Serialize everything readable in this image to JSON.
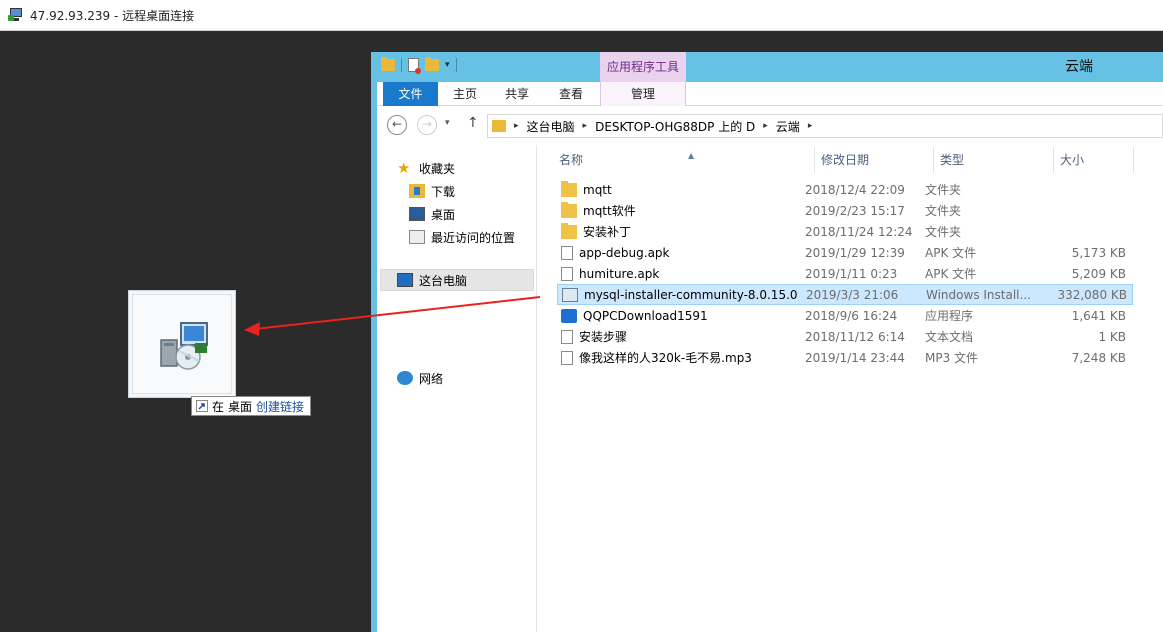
{
  "rdp": {
    "title": "47.92.93.239 - 远程桌面连接"
  },
  "drag": {
    "tooltip_prefix": "在",
    "tooltip_target": "桌面",
    "tooltip_action": "创建链接"
  },
  "explorer": {
    "window_title": "云端",
    "contextual_tab": "应用程序工具",
    "tabs": [
      "文件",
      "主页",
      "共享",
      "查看",
      "管理"
    ],
    "breadcrumb": [
      "这台电脑",
      "DESKTOP-OHG88DP 上的 D",
      "云端"
    ],
    "nav": {
      "favorites": "收藏夹",
      "downloads": "下载",
      "desktop": "桌面",
      "recent": "最近访问的位置",
      "this_pc": "这台电脑",
      "network": "网络"
    },
    "columns": [
      "名称",
      "修改日期",
      "类型",
      "大小"
    ],
    "files": [
      {
        "name": "mqtt",
        "date": "2018/12/4 22:09",
        "type": "文件夹",
        "size": "",
        "icon": "folder-icon"
      },
      {
        "name": "mqtt软件",
        "date": "2019/2/23 15:17",
        "type": "文件夹",
        "size": "",
        "icon": "folder-icon"
      },
      {
        "name": "安装补丁",
        "date": "2018/11/24 12:24",
        "type": "文件夹",
        "size": "",
        "icon": "folder-icon"
      },
      {
        "name": "app-debug.apk",
        "date": "2019/1/29 12:39",
        "type": "APK 文件",
        "size": "5,173 KB",
        "icon": "file-icon"
      },
      {
        "name": "humiture.apk",
        "date": "2019/1/11 0:23",
        "type": "APK 文件",
        "size": "5,209 KB",
        "icon": "file-icon"
      },
      {
        "name": "mysql-installer-community-8.0.15.0",
        "date": "2019/3/3 21:06",
        "type": "Windows Install...",
        "size": "332,080 KB",
        "icon": "installer-icon"
      },
      {
        "name": "QQPCDownload1591",
        "date": "2018/9/6 16:24",
        "type": "应用程序",
        "size": "1,641 KB",
        "icon": "qq-icon"
      },
      {
        "name": "安装步骤",
        "date": "2018/11/12 6:14",
        "type": "文本文档",
        "size": "1 KB",
        "icon": "file-icon"
      },
      {
        "name": "像我这样的人320k-毛不易.mp3",
        "date": "2019/1/14 23:44",
        "type": "MP3 文件",
        "size": "7,248 KB",
        "icon": "file-icon"
      }
    ]
  },
  "colors": {
    "title_blue": "#66c1e4",
    "file_tab": "#1979ca",
    "selection": "#cce8ff",
    "arrow": "#e8231d"
  }
}
